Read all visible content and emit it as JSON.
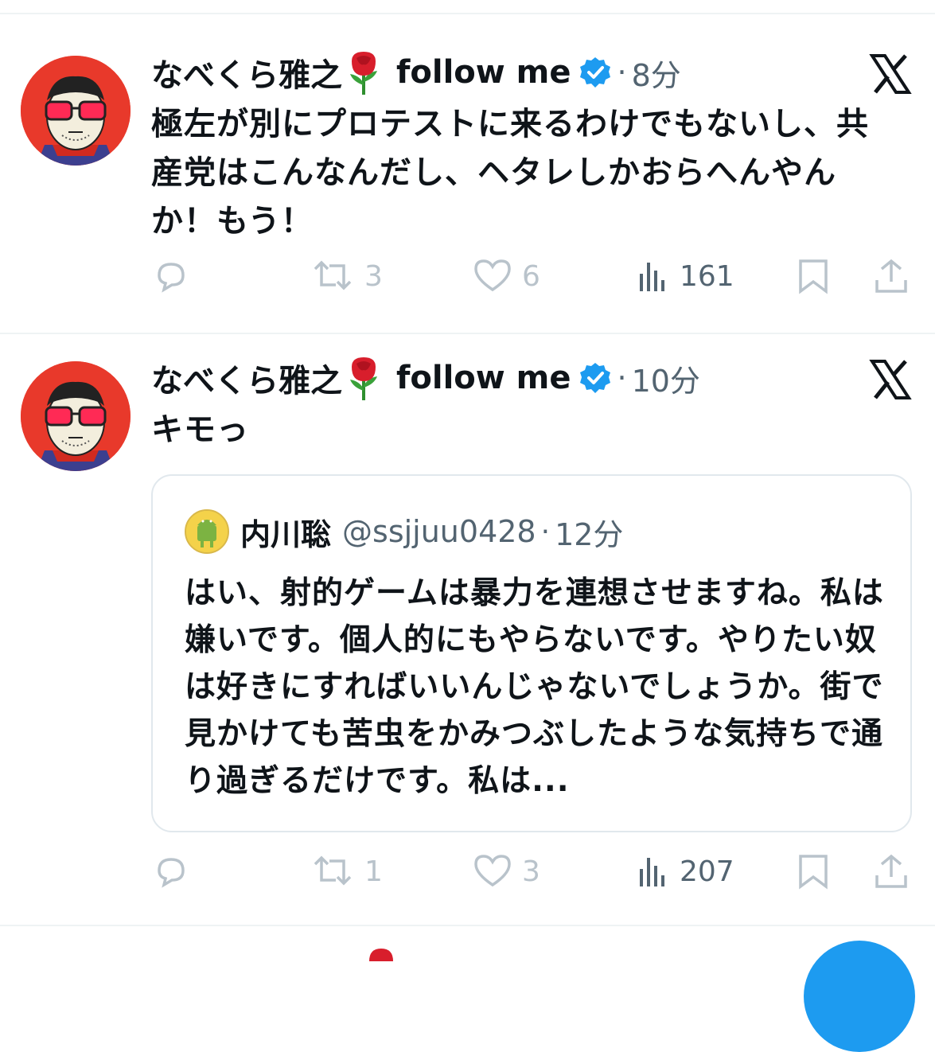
{
  "tweets": [
    {
      "author": "なべくら雅之",
      "display_suffix": "follow me",
      "time": "8分",
      "text": "極左が別にプロテストに来るわけでもないし、共産党はこんなんだし、ヘタレしかおらへんやんか！もう！",
      "stats": {
        "replies": "",
        "retweets": "3",
        "likes": "6",
        "views": "161"
      }
    },
    {
      "author": "なべくら雅之",
      "display_suffix": "follow me",
      "time": "10分",
      "text": "キモっ",
      "quote": {
        "author": "内川聡",
        "handle": "@ssjjuu0428",
        "time": "12分",
        "text": "はい、射的ゲームは暴力を連想させますね。私は嫌いです。個人的にもやらないです。やりたい奴は好きにすればいいんじゃないでしょうか。街で見かけても苦虫をかみつぶしたような気持ちで通り過ぎるだけです。私は..."
      },
      "stats": {
        "replies": "",
        "retweets": "1",
        "likes": "3",
        "views": "207"
      }
    }
  ],
  "separator_dot": "·",
  "colors": {
    "accent": "#1d9bf0",
    "muted": "#536471",
    "avatar_bg": "#e8392b"
  }
}
